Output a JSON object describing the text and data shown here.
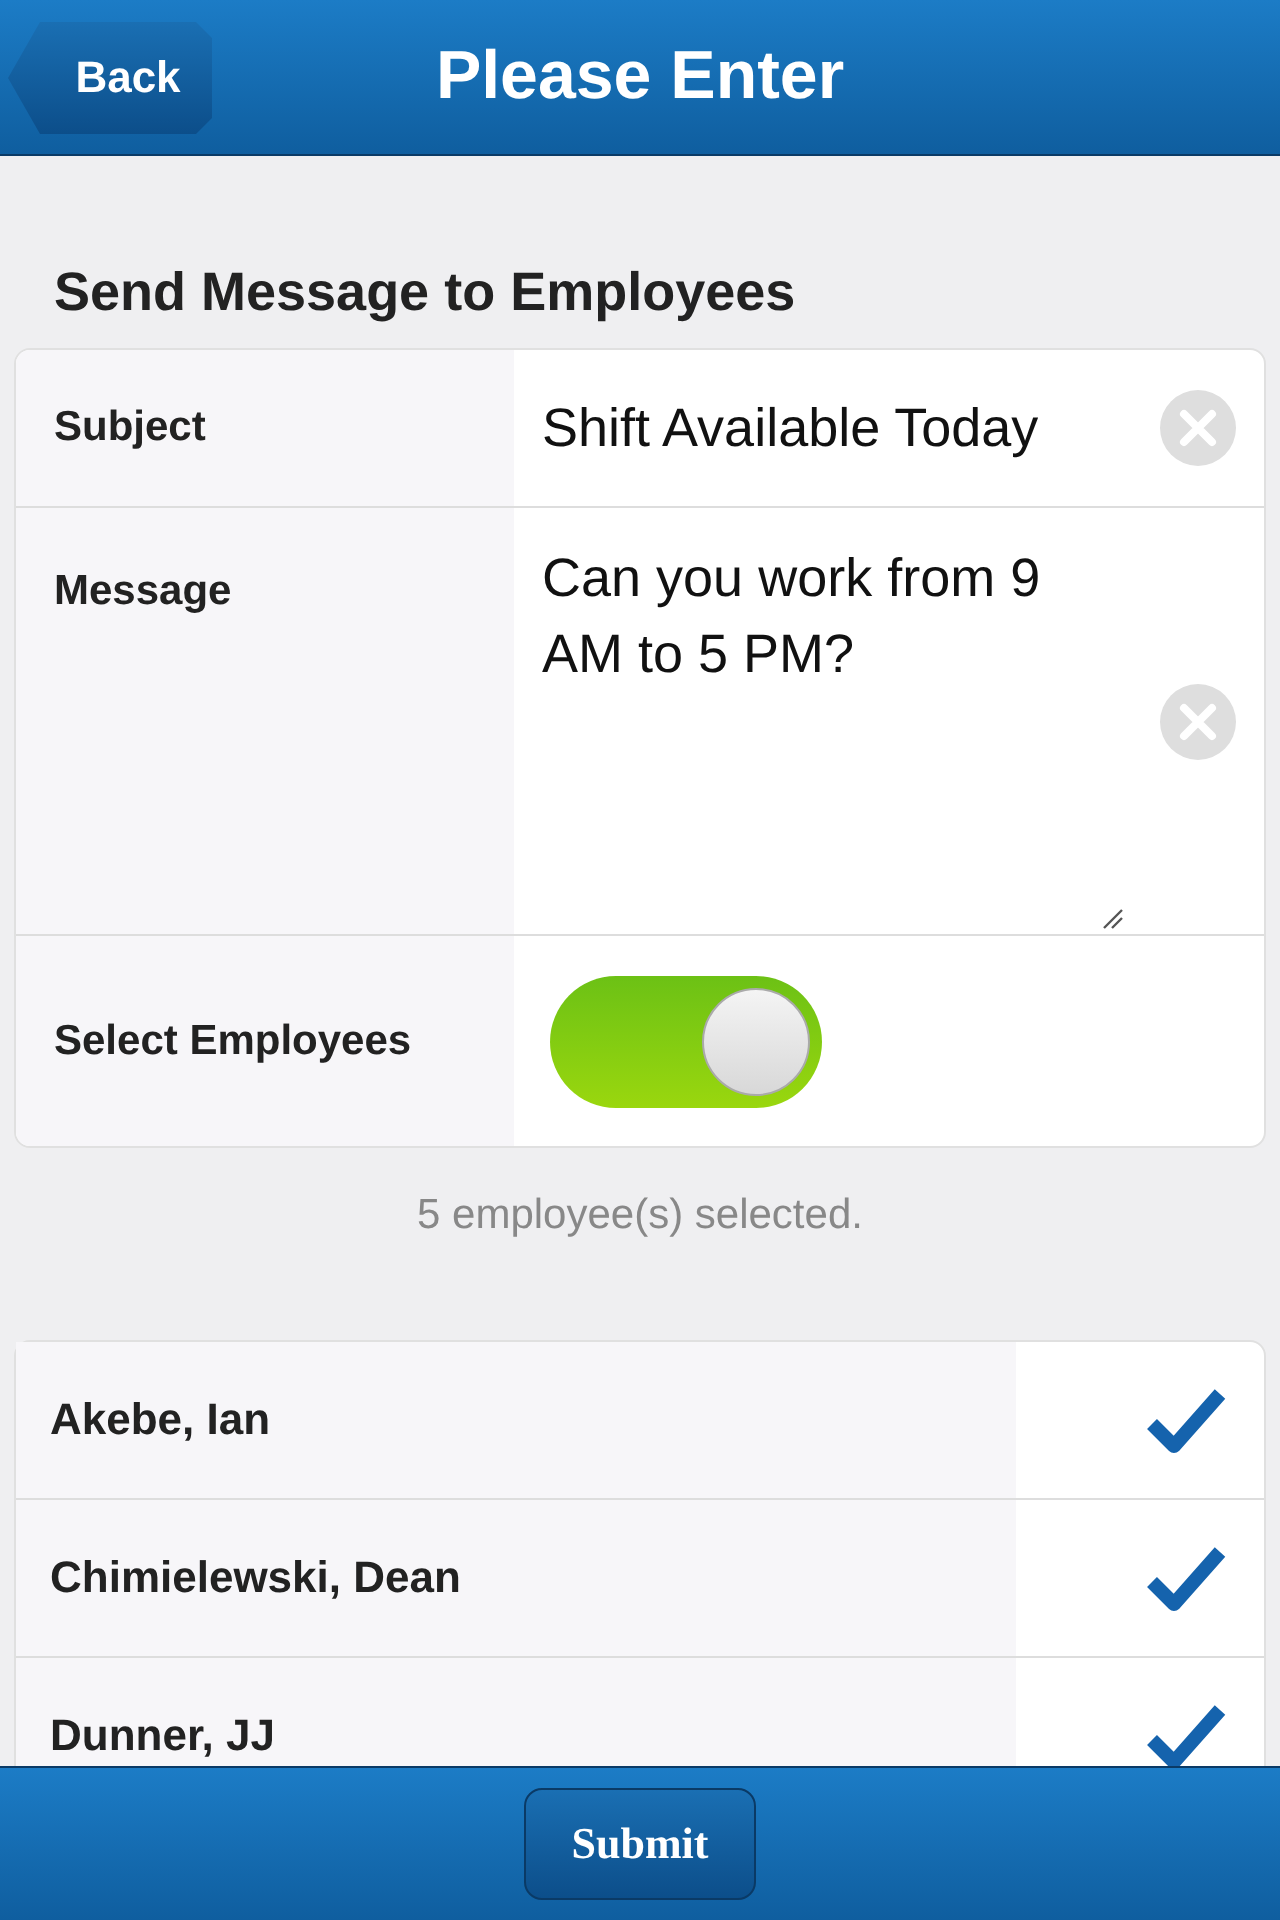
{
  "header": {
    "back": "Back",
    "title": "Please Enter"
  },
  "form": {
    "heading": "Send Message to Employees",
    "fields": [
      {
        "kind": "text",
        "label": "Subject",
        "value": "Shift Available Today"
      },
      {
        "kind": "textarea",
        "label": "Message",
        "value": "Can you work from 9 AM to 5 PM?"
      },
      {
        "kind": "toggle",
        "label": "Select Employees",
        "on": true
      }
    ]
  },
  "summary": "5 employee(s) selected.",
  "employees": [
    {
      "name": "Akebe, Ian",
      "checked": true
    },
    {
      "name": "Chimielewski, Dean",
      "checked": true
    },
    {
      "name": "Dunner, JJ",
      "checked": true
    }
  ],
  "footer": {
    "submit": "Submit"
  }
}
